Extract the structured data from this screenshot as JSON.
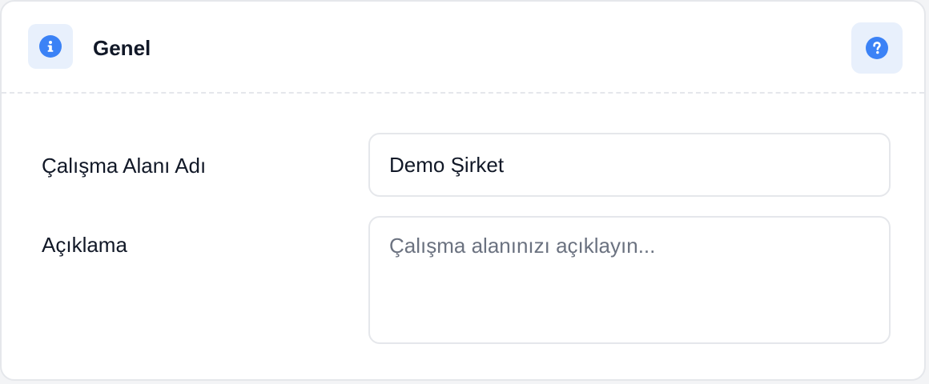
{
  "section": {
    "title": "Genel",
    "info_icon": "info-icon",
    "help_icon": "help-icon",
    "accent_color": "#3b82f6",
    "icon_tile_color": "#e8f0fc"
  },
  "fields": {
    "workspace_name": {
      "label": "Çalışma Alanı Adı",
      "value": "Demo Şirket"
    },
    "description": {
      "label": "Açıklama",
      "value": "",
      "placeholder": "Çalışma alanınızı açıklayın..."
    }
  }
}
